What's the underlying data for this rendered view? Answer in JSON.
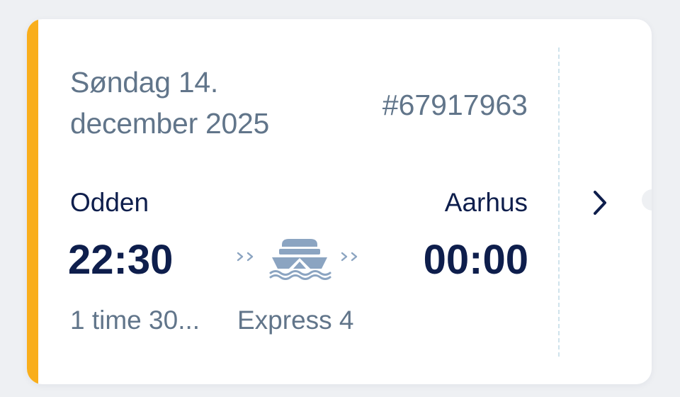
{
  "trip": {
    "date": "Søndag 14. december 2025",
    "booking_number": "#67917963",
    "origin": "Odden",
    "destination": "Aarhus",
    "departure_time": "22:30",
    "arrival_time": "00:00",
    "duration": "1 time 30...",
    "vessel": "Express 4"
  },
  "icons": {
    "transport": "ferry-icon",
    "direction": "double-chevron-right-icon",
    "open": "chevron-right-icon"
  },
  "colors": {
    "accent": "#f9ae1b",
    "primary_text": "#0e1e4c",
    "secondary_text": "#61758a",
    "icon": "#8ba4c1"
  }
}
